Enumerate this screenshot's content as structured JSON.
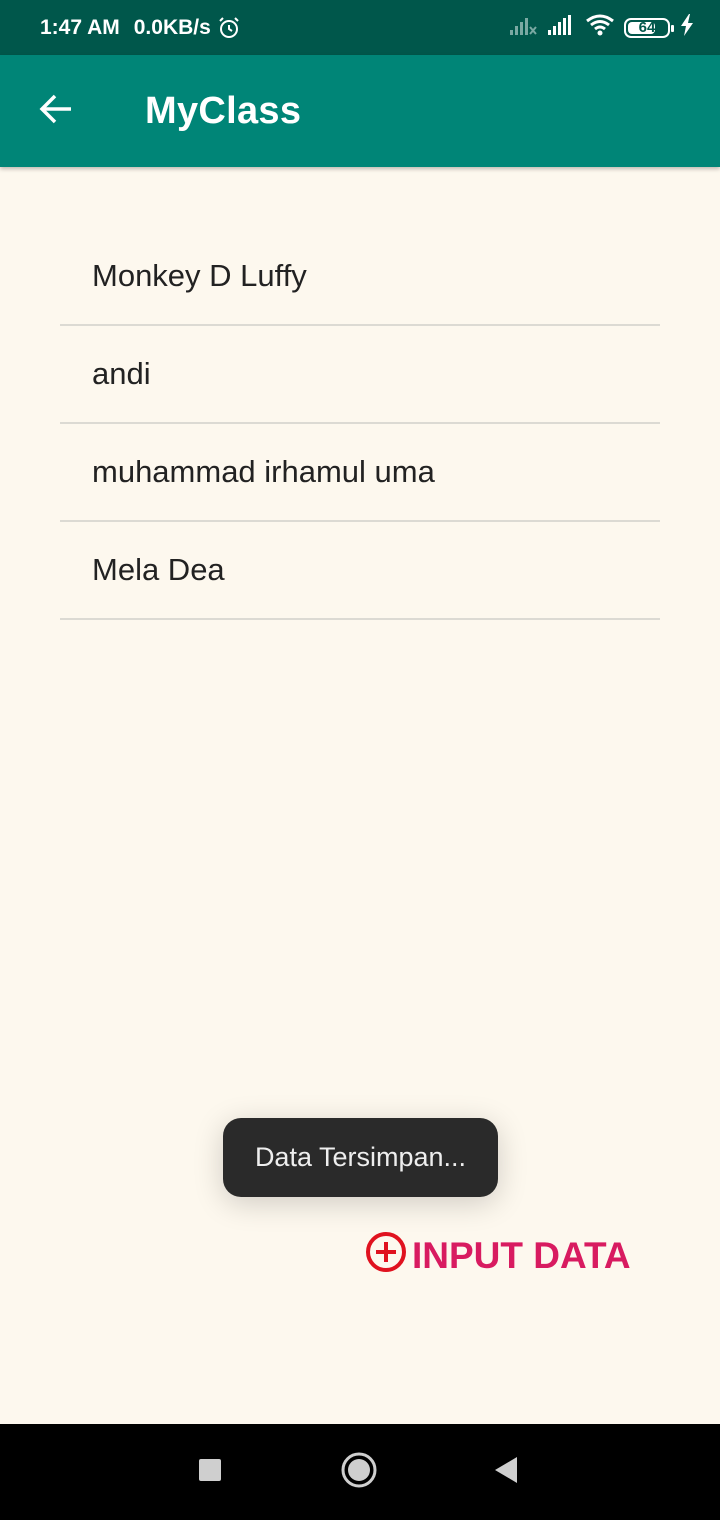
{
  "status_bar": {
    "time": "1:47 AM",
    "network_speed": "0.0KB/s",
    "battery_level": "64",
    "icons": [
      "alarm-icon",
      "signal-no-data-icon",
      "signal-icon",
      "wifi-icon",
      "battery-icon",
      "charging-icon"
    ]
  },
  "app_bar": {
    "title": "MyClass",
    "back_icon": "arrow-left-icon",
    "background_color": "#008577",
    "status_color": "#00574b"
  },
  "list": {
    "items": [
      {
        "label": "Monkey D Luffy"
      },
      {
        "label": "andi"
      },
      {
        "label": "muhammad irhamul uma"
      },
      {
        "label": "Mela Dea"
      }
    ]
  },
  "toast": {
    "message": "Data Tersimpan..."
  },
  "input_button": {
    "label": "INPUT DATA",
    "icon": "add-circle-icon",
    "color": "#d81b60"
  },
  "nav_bar": {
    "icons": [
      "recents-square-icon",
      "home-circle-icon",
      "back-triangle-icon"
    ]
  }
}
